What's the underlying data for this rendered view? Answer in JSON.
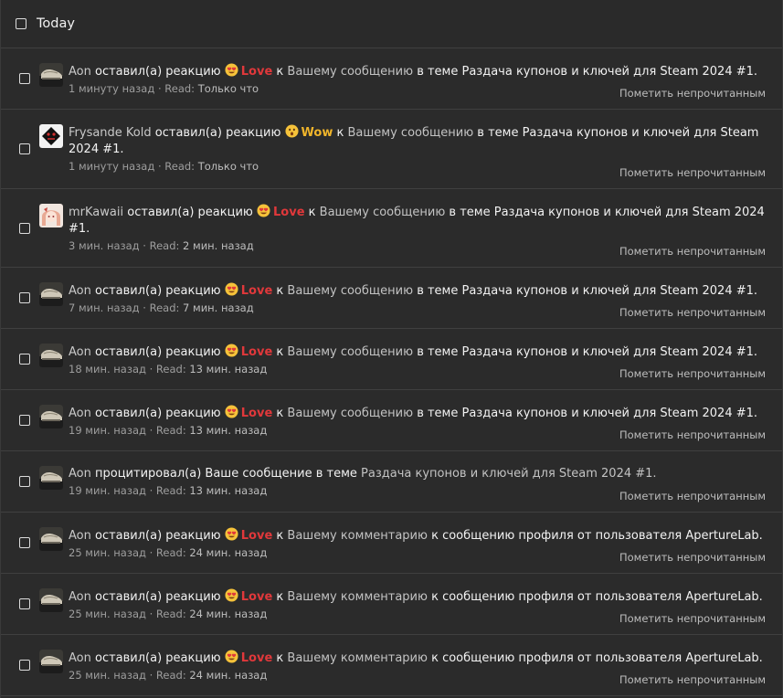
{
  "header": {
    "title": "Today"
  },
  "common": {
    "reacted": "оставил(а) реакцию",
    "to": "к",
    "your_message": "Вашему сообщению",
    "your_comment": "Вашему комментарию",
    "in_thread": "в теме",
    "thread": "Раздача купонов и ключей для Steam 2024 #1.",
    "profile_msg": "к сообщению профиля от пользователя ApertureLab.",
    "quoted": "процитировал(а) Ваше сообщение в теме",
    "read_label": "Read:",
    "mark_unread": "Пометить непрочитанным"
  },
  "colors": {
    "love": "#e0383b",
    "wow": "#f0b52b",
    "background": "#2b2b2b",
    "divider": "#404040"
  },
  "rows": [
    {
      "user": "Aon",
      "type": "reaction",
      "reaction": "Love",
      "emoji": "heart-eyes-emoji",
      "target": "message",
      "time": "1 минуту назад",
      "read": "Только что"
    },
    {
      "user": "Frysande Kold",
      "type": "reaction",
      "reaction": "Wow",
      "emoji": "astonished-emoji",
      "target": "message",
      "time": "1 минуту назад",
      "read": "Только что"
    },
    {
      "user": "mrKawaii",
      "type": "reaction",
      "reaction": "Love",
      "emoji": "heart-eyes-emoji",
      "target": "message",
      "time": "3 мин. назад",
      "read": "2 мин. назад"
    },
    {
      "user": "Aon",
      "type": "reaction",
      "reaction": "Love",
      "emoji": "heart-eyes-emoji",
      "target": "message",
      "time": "7 мин. назад",
      "read": "7 мин. назад"
    },
    {
      "user": "Aon",
      "type": "reaction",
      "reaction": "Love",
      "emoji": "heart-eyes-emoji",
      "target": "message",
      "time": "18 мин. назад",
      "read": "13 мин. назад"
    },
    {
      "user": "Aon",
      "type": "reaction",
      "reaction": "Love",
      "emoji": "heart-eyes-emoji",
      "target": "message",
      "time": "19 мин. назад",
      "read": "13 мин. назад"
    },
    {
      "user": "Aon",
      "type": "quote",
      "time": "19 мин. назад",
      "read": "13 мин. назад"
    },
    {
      "user": "Aon",
      "type": "reaction",
      "reaction": "Love",
      "emoji": "heart-eyes-emoji",
      "target": "comment",
      "time": "25 мин. назад",
      "read": "24 мин. назад"
    },
    {
      "user": "Aon",
      "type": "reaction",
      "reaction": "Love",
      "emoji": "heart-eyes-emoji",
      "target": "comment",
      "time": "25 мин. назад",
      "read": "24 мин. назад"
    },
    {
      "user": "Aon",
      "type": "reaction",
      "reaction": "Love",
      "emoji": "heart-eyes-emoji",
      "target": "comment",
      "time": "25 мин. назад",
      "read": "24 мин. назад"
    }
  ]
}
